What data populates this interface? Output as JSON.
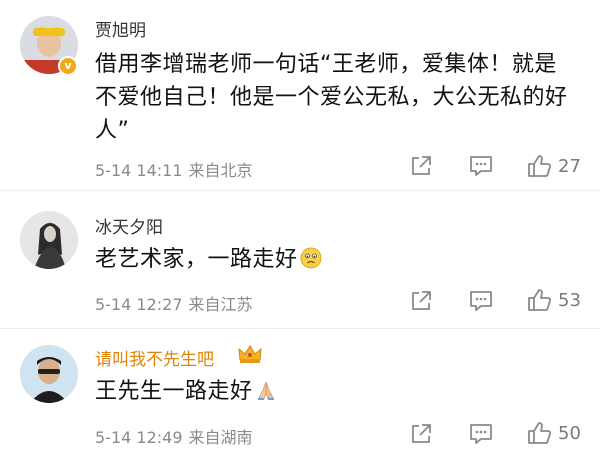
{
  "comments": [
    {
      "username": "贾旭明",
      "text": "借用李增瑞老师一句话“王老师，爱集体！就是不爱他自己！他是一个爱公无私，大公无私的好人”",
      "time": "5-14 14:11",
      "location": "来自北京",
      "likes": "27",
      "avatar_icon": "person-avatar-icon",
      "verified": true
    },
    {
      "username": "冰天夕阳",
      "text": "老艺术家，一路走好",
      "emoji_icon": "sad-face-emoji-icon",
      "time": "5-14 12:27",
      "location": "来自江苏",
      "likes": "53",
      "avatar_icon": "person-avatar-icon"
    },
    {
      "username": "请叫我不先生吧",
      "username_color": "#e0860a",
      "badge_icon": "crown-icon",
      "text": "王先生一路走好",
      "emoji_icon": "praying-hands-emoji-icon",
      "time": "5-14 12:49",
      "location": "来自湖南",
      "likes": "50",
      "avatar_icon": "person-avatar-icon"
    }
  ],
  "action_icons": [
    "share-icon",
    "comment-icon",
    "like-icon"
  ]
}
